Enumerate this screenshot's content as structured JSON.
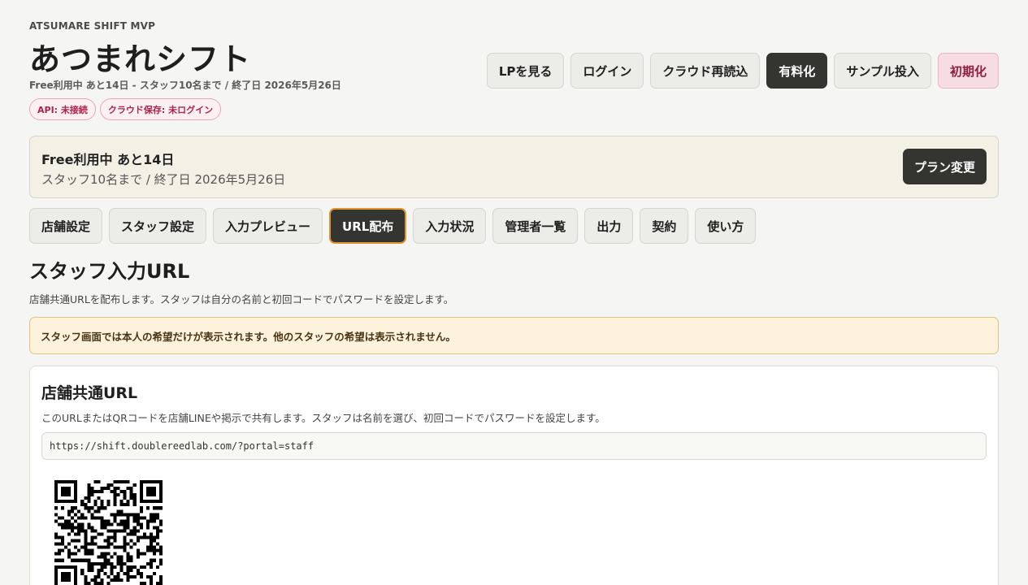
{
  "header": {
    "eyebrow": "ATSUMARE SHIFT MVP",
    "title": "あつまれシフト",
    "plan_line": "Free利用中 あと14日 - スタッフ10名まで / 終了日 2026年5月26日",
    "badges": [
      "API: 未接続",
      "クラウド保存: 未ログイン"
    ],
    "actions": {
      "lp": "LPを見る",
      "login": "ログイン",
      "reload": "クラウド再読込",
      "upgrade": "有料化",
      "sample": "サンプル投入",
      "reset": "初期化"
    }
  },
  "plan_banner": {
    "title": "Free利用中 あと14日",
    "subtitle": "スタッフ10名まで / 終了日 2026年5月26日",
    "change_label": "プラン変更"
  },
  "tabs": [
    "店舗設定",
    "スタッフ設定",
    "入力プレビュー",
    "URL配布",
    "入力状況",
    "管理者一覧",
    "出力",
    "契約",
    "使い方"
  ],
  "active_tab": "URL配布",
  "section": {
    "title": "スタッフ入力URL",
    "description": "店舗共通URLを配布します。スタッフは自分の名前と初回コードでパスワードを設定します。"
  },
  "notice": "スタッフ画面では本人の希望だけが表示されます。他のスタッフの希望は表示されません。",
  "card": {
    "title": "店舗共通URL",
    "description": "このURLまたはQRコードを店舗LINEや掲示で共有します。スタッフは名前を選び、初回コードでパスワードを設定します。",
    "url": "https://shift.doublereedlab.com/?portal=staff"
  },
  "colors": {
    "dark_button": "#343431",
    "active_tab_border": "#e0932e",
    "badge_text": "#b0234b",
    "notice_bg": "#fdf3dd"
  }
}
